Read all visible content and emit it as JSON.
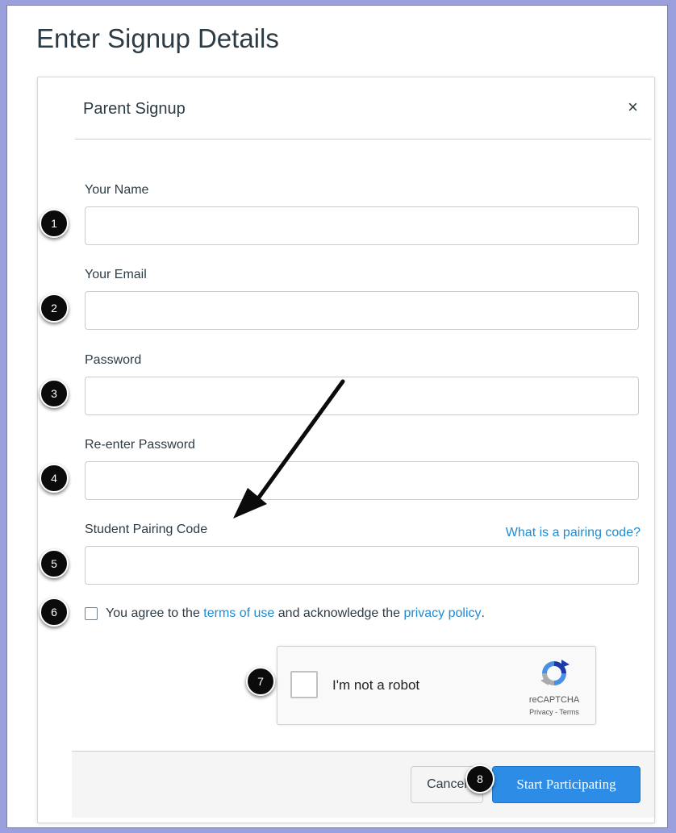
{
  "page": {
    "title": "Enter Signup Details"
  },
  "dialog": {
    "title": "Parent Signup",
    "close_glyph": "×"
  },
  "fields": {
    "name": {
      "label": "Your Name",
      "value": ""
    },
    "email": {
      "label": "Your Email",
      "value": ""
    },
    "password": {
      "label": "Password",
      "value": ""
    },
    "reenter_password": {
      "label": "Re-enter Password",
      "value": ""
    },
    "pairing_code": {
      "label": "Student Pairing Code",
      "value": "",
      "help_link": "What is a pairing code?"
    }
  },
  "terms": {
    "checked": false,
    "prefix": "You agree to the",
    "terms_link": "terms of use",
    "middle": "and acknowledge the",
    "privacy_link": "privacy policy",
    "suffix": "."
  },
  "recaptcha": {
    "label": "I'm not a robot",
    "brand": "reCAPTCHA",
    "links": "Privacy - Terms",
    "icon": "recaptcha-logo"
  },
  "footer": {
    "cancel_label": "Cancel",
    "submit_label": "Start Participating"
  },
  "annotations": {
    "markers": [
      "1",
      "2",
      "3",
      "4",
      "5",
      "6",
      "7",
      "8"
    ],
    "arrow": "arrow pointing to Student Pairing Code"
  },
  "colors": {
    "link": "#1f8bd3",
    "primary_button": "#2d8de6",
    "frame_background": "#9aa0dc"
  }
}
